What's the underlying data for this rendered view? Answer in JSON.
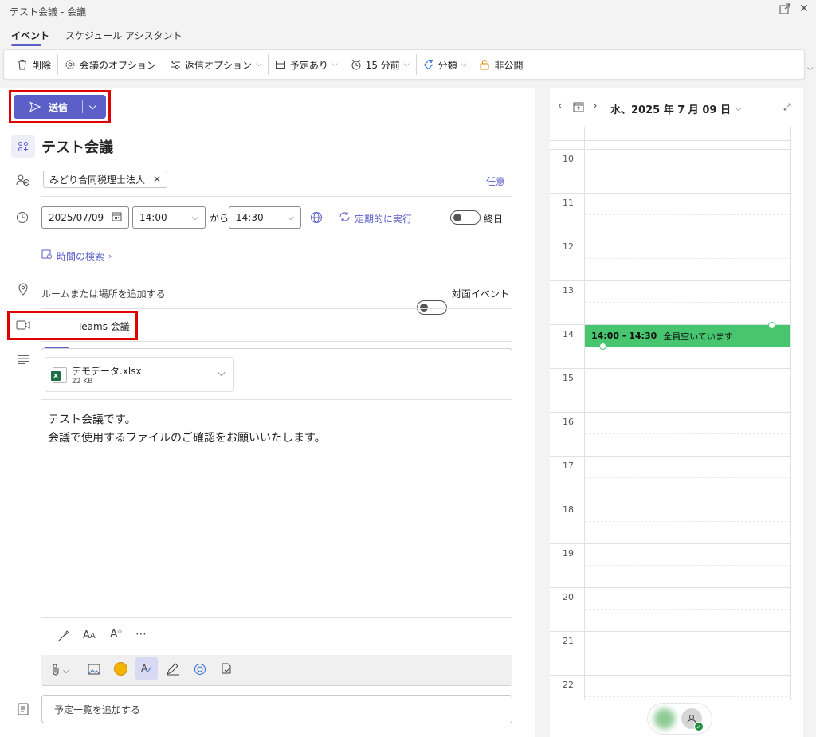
{
  "window": {
    "title": "テスト会議 - 会議"
  },
  "tabs": [
    {
      "label": "イベント"
    },
    {
      "label": "スケジュール アシスタント"
    }
  ],
  "toolbar": {
    "delete": "削除",
    "meeting_options": "会議のオプション",
    "reply_options": "返信オプション",
    "busy": "予定あり",
    "reminder": "15 分前",
    "categorize": "分類",
    "private": "非公開"
  },
  "send": {
    "label": "送信"
  },
  "title": "テスト会議",
  "attendees": {
    "chip": "みどり合同税理士法人",
    "optional": "任意"
  },
  "datetime": {
    "date": "2025/07/09",
    "start": "14:00",
    "from": "から",
    "end": "14:30",
    "recurring": "定期的に実行",
    "allday": "終日"
  },
  "find_time": "時間の検索",
  "location": {
    "placeholder": "ルームまたは場所を追加する",
    "inperson": "対面イベント"
  },
  "teams": {
    "label": "Teams 会議"
  },
  "attachment": {
    "name": "デモデータ.xlsx",
    "size": "22 KB"
  },
  "body": {
    "line1": "テスト会議です。",
    "line2": "会議で使用するファイルのご確認をお願いいたします。"
  },
  "agenda": {
    "placeholder": "予定一覧を追加する"
  },
  "calendar": {
    "date": "水、2025 年 7 月 09 日",
    "hours": [
      "10",
      "11",
      "12",
      "13",
      "14",
      "15",
      "16",
      "17",
      "18",
      "19",
      "20",
      "21",
      "22"
    ],
    "event_time": "14:00 - 14:30",
    "event_status": "全員空いています"
  },
  "colors": {
    "accent": "#5b5fc7",
    "event": "#47c56f",
    "highlight": "#e00000"
  }
}
